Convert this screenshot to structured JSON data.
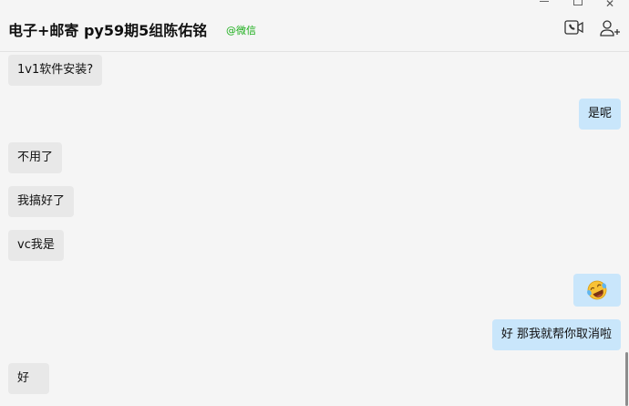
{
  "window": {
    "minimize_icon": "minimize-icon",
    "maximize_icon": "maximize-icon",
    "close_icon": "close-icon",
    "close_glyph": "✕"
  },
  "header": {
    "title": "电子+邮寄 py59期5组陈佑铭",
    "tag": "@微信",
    "tag_color": "#1aad19",
    "video_call_icon": "video-call-icon",
    "add_member_icon": "add-member-icon"
  },
  "messages": [
    {
      "side": "left",
      "text": "1v1软件安装?"
    },
    {
      "side": "right",
      "text": "是呢"
    },
    {
      "side": "left",
      "text": "不用了"
    },
    {
      "side": "left",
      "text": "我搞好了"
    },
    {
      "side": "left",
      "text": "vc我是"
    },
    {
      "side": "right",
      "text": "",
      "emoji": "laughing-tears-emoji"
    },
    {
      "side": "right",
      "text": "好 那我就帮你取消啦"
    },
    {
      "side": "left",
      "text": "好"
    }
  ],
  "colors": {
    "incoming_bubble": "#e8e8e8",
    "outgoing_bubble": "#c9e6fb",
    "background": "#f5f5f5"
  }
}
